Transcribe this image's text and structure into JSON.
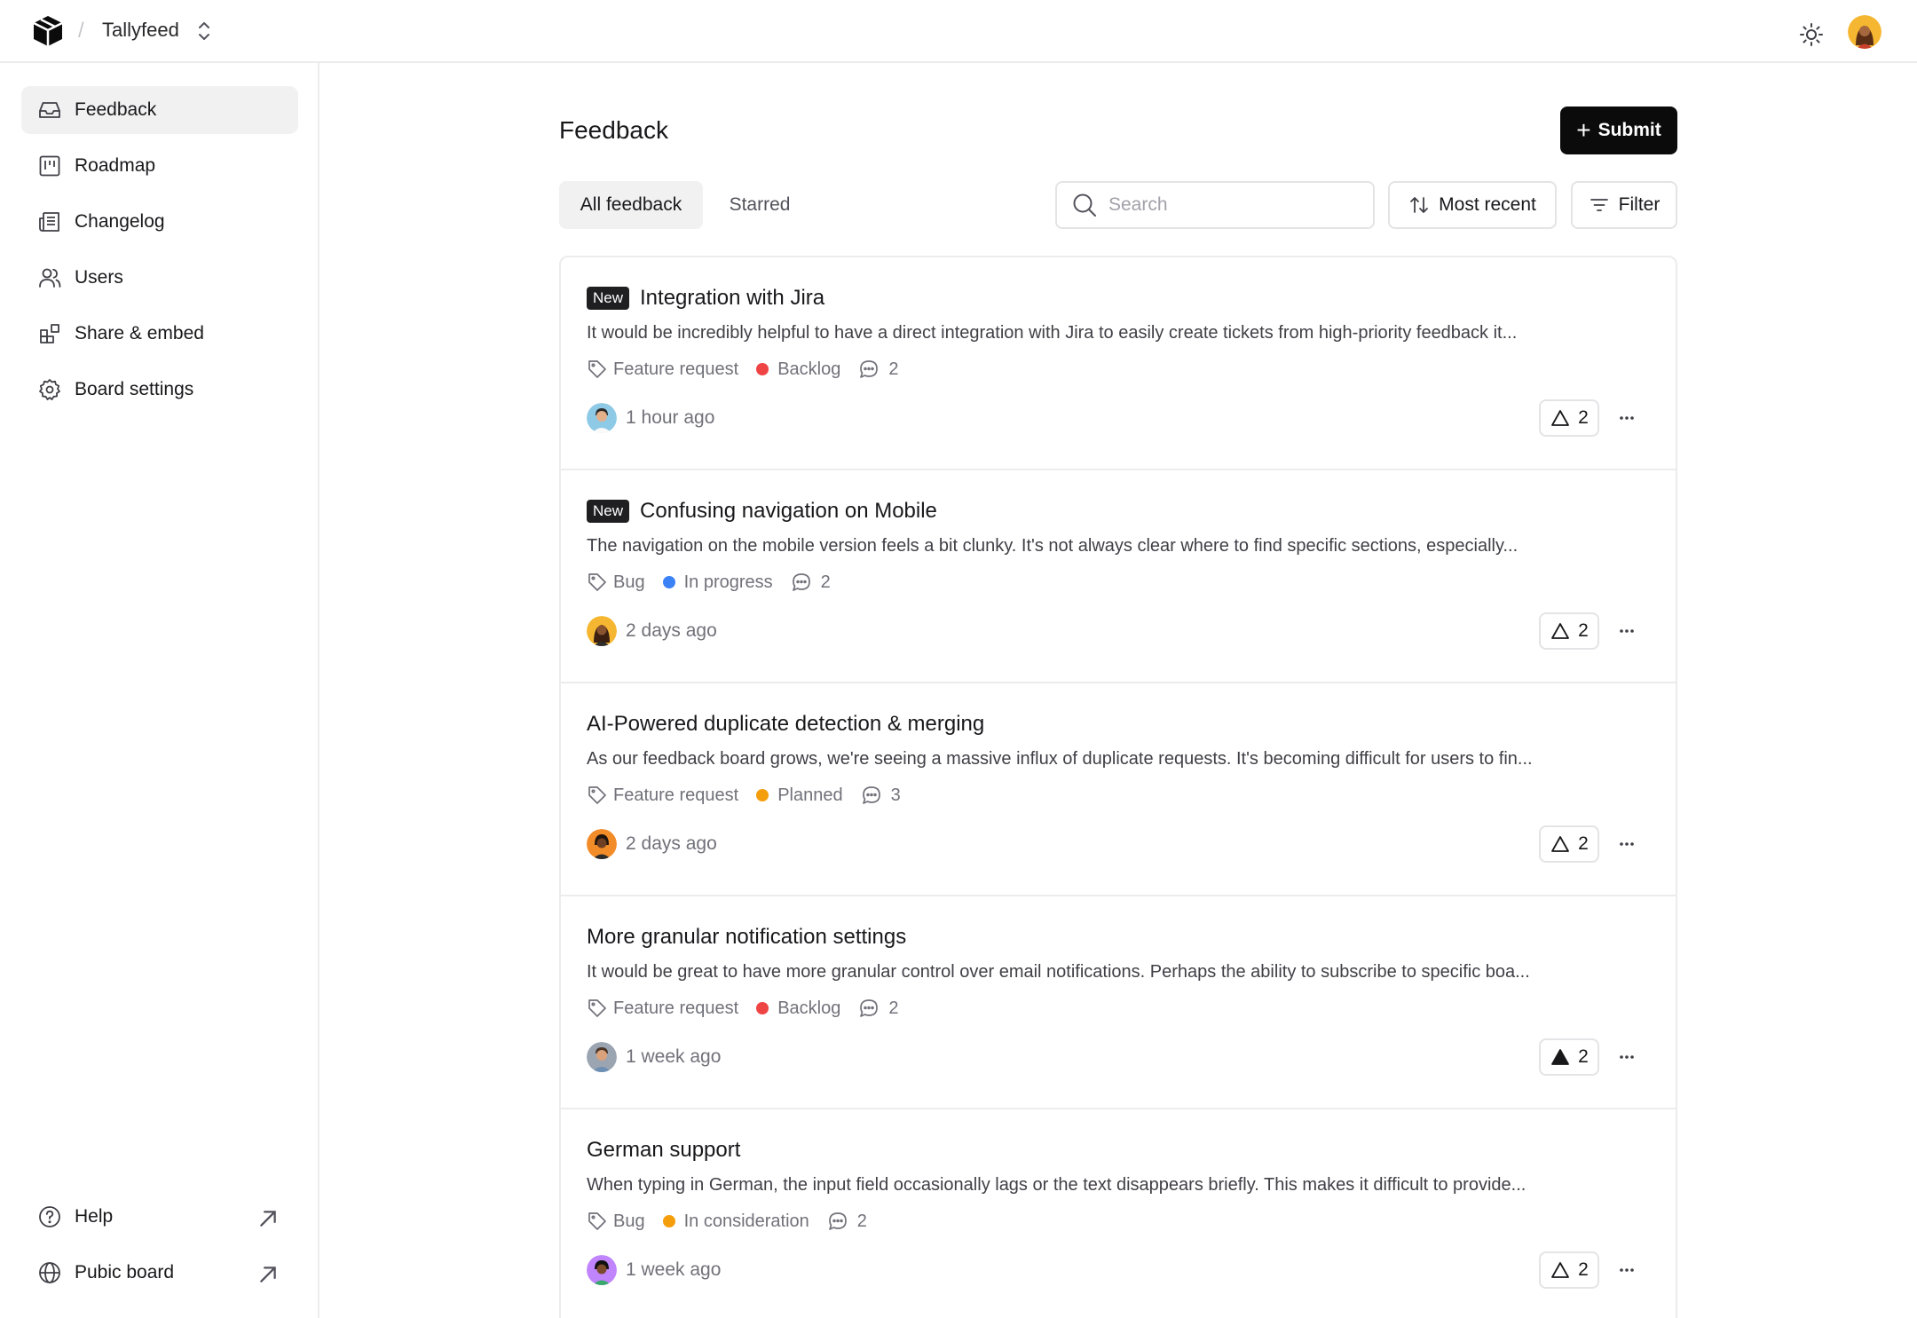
{
  "header": {
    "workspace_name": "Tallyfeed",
    "separator": "/",
    "icons": {
      "logo": "box-logo-icon",
      "switcher": "chevron-up-down-icon",
      "theme": "sun-icon"
    }
  },
  "sidebar": {
    "items": [
      {
        "label": "Feedback",
        "icon": "inbox-icon",
        "active": true
      },
      {
        "label": "Roadmap",
        "icon": "kanban-icon",
        "active": false
      },
      {
        "label": "Changelog",
        "icon": "newspaper-icon",
        "active": false
      },
      {
        "label": "Users",
        "icon": "users-icon",
        "active": false
      },
      {
        "label": "Share & embed",
        "icon": "blocks-icon",
        "active": false
      },
      {
        "label": "Board settings",
        "icon": "gear-icon",
        "active": false
      }
    ],
    "footer_items": [
      {
        "label": "Help",
        "icon": "help-circle-icon"
      },
      {
        "label": "Pubic board",
        "icon": "globe-icon"
      }
    ]
  },
  "main": {
    "title": "Feedback",
    "submit_label": "Submit",
    "tabs": [
      {
        "label": "All feedback",
        "active": true
      },
      {
        "label": "Starred",
        "active": false
      }
    ],
    "search_placeholder": "Search",
    "sort_label": "Most recent",
    "filter_label": "Filter"
  },
  "feedback": [
    {
      "badge": "New",
      "title": "Integration with Jira",
      "description": "It would be incredibly helpful to have a direct integration with Jira to easily create tickets from high-priority feedback it...",
      "tag": "Feature request",
      "status": "Backlog",
      "status_color": "#ef4444",
      "comments": "2",
      "time": "1 hour ago",
      "votes": "2",
      "voted": false
    },
    {
      "badge": "New",
      "title": "Confusing navigation on Mobile",
      "description": "The navigation on the mobile version feels a bit clunky. It's not always clear where to find specific sections, especially...",
      "tag": "Bug",
      "status": "In progress",
      "status_color": "#3b82f6",
      "comments": "2",
      "time": "2 days ago",
      "votes": "2",
      "voted": false
    },
    {
      "badge": "",
      "title": "AI-Powered duplicate detection & merging",
      "description": "As our feedback board grows, we're seeing a massive influx of duplicate requests. It's becoming difficult for users to fin...",
      "tag": "Feature request",
      "status": "Planned",
      "status_color": "#f59e0b",
      "comments": "3",
      "time": "2 days ago",
      "votes": "2",
      "voted": false
    },
    {
      "badge": "",
      "title": "More granular notification settings",
      "description": "It would be great to have more granular control over email notifications. Perhaps the ability to subscribe to specific boa...",
      "tag": "Feature request",
      "status": "Backlog",
      "status_color": "#ef4444",
      "comments": "2",
      "time": "1 week ago",
      "votes": "2",
      "voted": true
    },
    {
      "badge": "",
      "title": "German support",
      "description": "When typing in German, the input field occasionally lags or the text disappears briefly. This makes it difficult to provide...",
      "tag": "Bug",
      "status": "In consideration",
      "status_color": "#f59e0b",
      "comments": "2",
      "time": "1 week ago",
      "votes": "2",
      "voted": false
    }
  ]
}
